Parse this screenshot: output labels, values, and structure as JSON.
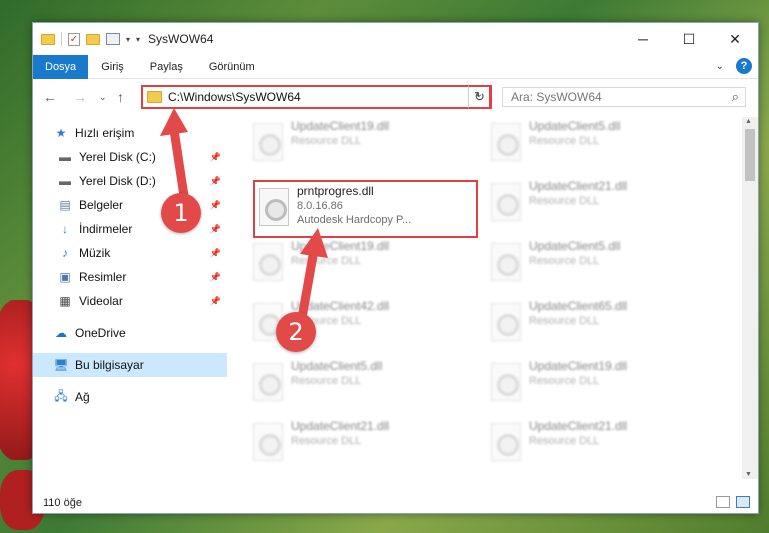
{
  "window": {
    "title": "SysWOW64"
  },
  "ribbon": {
    "tabs": [
      {
        "label": "Dosya",
        "active": true
      },
      {
        "label": "Giriş"
      },
      {
        "label": "Paylaş"
      },
      {
        "label": "Görünüm"
      }
    ]
  },
  "address": {
    "path": "C:\\Windows\\SysWOW64"
  },
  "search": {
    "placeholder": "Ara: SysWOW64"
  },
  "sidebar": {
    "items": [
      {
        "label": "Hızlı erişim",
        "icon": "star-icon"
      },
      {
        "label": "Yerel Disk (C:)",
        "icon": "drive-icon",
        "pinned": true
      },
      {
        "label": "Yerel Disk (D:)",
        "icon": "drive-icon",
        "pinned": true
      },
      {
        "label": "Belgeler",
        "icon": "documents-icon",
        "pinned": true
      },
      {
        "label": "İndirmeler",
        "icon": "download-icon",
        "pinned": true
      },
      {
        "label": "Müzik",
        "icon": "music-icon",
        "pinned": true
      },
      {
        "label": "Resimler",
        "icon": "pictures-icon",
        "pinned": true
      },
      {
        "label": "Videolar",
        "icon": "videos-icon",
        "pinned": true
      },
      {
        "label": "OneDrive",
        "icon": "cloud-icon"
      },
      {
        "label": "Bu bilgisayar",
        "icon": "computer-icon",
        "selected": true
      },
      {
        "label": "Ağ",
        "icon": "network-icon"
      }
    ]
  },
  "files": {
    "highlighted": {
      "name": "prntprogres.dll",
      "version": "8.0.16.86",
      "description": "Autodesk Hardcopy P..."
    },
    "left": [
      {
        "name": "UpdateClient19.dll",
        "type": "Resource DLL"
      },
      {
        "name": "UpdateClient19.dll",
        "type": "Resource DLL"
      },
      {
        "name": "UpdateClient42.dll",
        "type": "Resource DLL"
      },
      {
        "name": "UpdateClient5.dll",
        "type": "Resource DLL"
      },
      {
        "name": "UpdateClient21.dll",
        "type": "Resource DLL"
      }
    ],
    "right": [
      {
        "name": "UpdateClient5.dll",
        "type": "Resource DLL"
      },
      {
        "name": "UpdateClient21.dll",
        "type": "Resource DLL"
      },
      {
        "name": "UpdateClient5.dll",
        "type": "Resource DLL"
      },
      {
        "name": "UpdateClient65.dll",
        "type": "Resource DLL"
      },
      {
        "name": "UpdateClient19.dll",
        "type": "Resource DLL"
      },
      {
        "name": "UpdateClient21.dll",
        "type": "Resource DLL"
      }
    ]
  },
  "status": {
    "count": "110 öğe"
  },
  "annotations": {
    "step1": "1",
    "step2": "2",
    "color": "#e24a4a"
  }
}
